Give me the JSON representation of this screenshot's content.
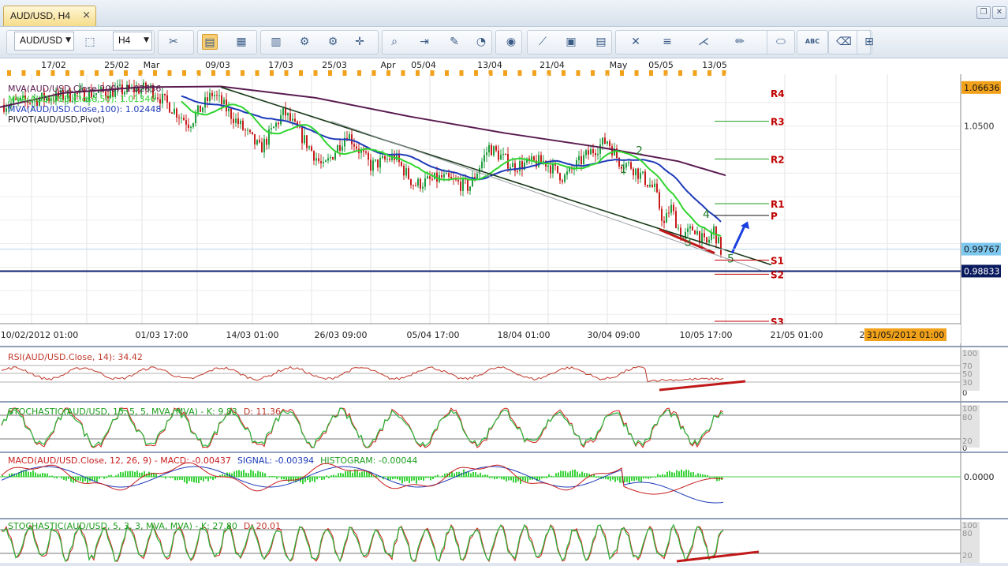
{
  "window": {
    "tab_title": "AUD/USD, H4",
    "close_glyph": "×",
    "restore_glyph": "❐",
    "close_window_glyph": "✕"
  },
  "toolbar": {
    "symbol": "AUD/USD",
    "timeframe": "H4",
    "dropdown_glyph": "▼",
    "icons": [
      {
        "name": "chart-type-icon",
        "glyph": "⬚"
      },
      {
        "name": "remove-indicator-icon",
        "glyph": "✂"
      },
      {
        "name": "chart-template-icon",
        "glyph": "▤"
      },
      {
        "name": "bar-chart-icon",
        "glyph": "▦"
      },
      {
        "name": "candles-icon",
        "glyph": "▥"
      },
      {
        "name": "indicators-icon",
        "glyph": "⚙"
      },
      {
        "name": "strategies-icon",
        "glyph": "⚙"
      },
      {
        "name": "crosshair-icon",
        "glyph": "✛"
      },
      {
        "name": "zoom-icon",
        "glyph": "⌕"
      },
      {
        "name": "autoscroll-icon",
        "glyph": "⇥"
      },
      {
        "name": "chart-edit-icon",
        "glyph": "✎"
      },
      {
        "name": "clock-icon",
        "glyph": "◔"
      },
      {
        "name": "globe-icon",
        "glyph": "◉"
      },
      {
        "name": "ruler-icon",
        "glyph": "⟋"
      },
      {
        "name": "image-icon",
        "glyph": "▣"
      },
      {
        "name": "properties-icon",
        "glyph": "▤"
      },
      {
        "name": "draw-lines-icon",
        "glyph": "✕"
      },
      {
        "name": "horizontal-lines-icon",
        "glyph": "≡"
      },
      {
        "name": "fan-icon",
        "glyph": "⋌"
      },
      {
        "name": "pencil-icon",
        "glyph": "✏"
      },
      {
        "name": "ellipse-icon",
        "glyph": "⬭"
      },
      {
        "name": "text-icon",
        "glyph": "ABC"
      },
      {
        "name": "eraser-icon",
        "glyph": "⌫"
      },
      {
        "name": "hierarchy-icon",
        "glyph": "⊞"
      },
      {
        "name": "more-icon",
        "glyph": "⋮"
      }
    ]
  },
  "main_chart": {
    "legend": [
      {
        "text": "MVA(AUD/USD.Close,200): 1.02836",
        "color": "#5a1b50"
      },
      {
        "text": "MVA(AUD/USD.Close,50): 1.01346",
        "color": "#2fd52f"
      },
      {
        "text": "MVA(AUD/USD.Close,100): 1.02448",
        "color": "#1e3bb8"
      },
      {
        "text": "PIVOT(AUD/USD,Pivot)",
        "color": "#222222"
      }
    ],
    "top_dates": [
      "17/02",
      "25/02",
      "Mar",
      "09/03",
      "17/03",
      "25/03",
      "Apr",
      "05/04",
      "13/04",
      "21/04",
      "May",
      "05/05",
      "13/05"
    ],
    "bottom_dates": [
      "10/02/2012 01:00",
      "01/03 17:00",
      "14/03 01:00",
      "26/03 09:00",
      "05/04 17:00",
      "18/04 01:00",
      "30/04 09:00",
      "10/05 17:00",
      "21/05 01:00",
      "2"
    ],
    "bottom_highlight": "31/05/2012 01:00",
    "price_ticks": [
      "1.0500"
    ],
    "price_labels": {
      "top": "1.06636",
      "current": "0.99767",
      "support": "0.98833"
    },
    "pivot_labels": [
      "R4",
      "R3",
      "R2",
      "R1",
      "P",
      "S1",
      "S2",
      "S3"
    ],
    "wave_labels": [
      "1",
      "2",
      "3",
      "4",
      "5"
    ]
  },
  "indicators": {
    "rsi": {
      "label": "RSI(AUD/USD.Close, 14): 34.42",
      "color": "#c0392b",
      "levels": [
        "100",
        "70",
        "50",
        "30",
        "0"
      ]
    },
    "stoch1": {
      "label": "STOCHASTIC(AUD/USD, 15, 5, 5, MVA, MVA)",
      "k": "K: 9.83",
      "d": "D: 11.36",
      "levels": [
        "100",
        "80",
        "20",
        "0"
      ]
    },
    "macd": {
      "label": "MACD(AUD/USD.Close, 12, 26, 9)",
      "macd": "MACD: -0.00437",
      "signal": "SIGNAL: -0.00394",
      "histogram": "HISTOGRAM: -0.00044",
      "zero": "0.0000"
    },
    "stoch2": {
      "label": "STOCHASTIC(AUD/USD, 5, 3, 3, MVA, MVA)",
      "k": "K: 27.80",
      "d": "D: 20.01",
      "levels": [
        "100",
        "80",
        "20"
      ]
    }
  },
  "colors": {
    "ma200": "#5a1b50",
    "ma50": "#2fd52f",
    "ma100": "#1e3bb8",
    "bull": "#1f9e3f",
    "bear": "#c81d1d",
    "trend": "#1a3a1a",
    "divergence": "#c01818",
    "arrow": "#1b3fe0",
    "support": "#0b1f6e",
    "price_badge": "#7ec8ef",
    "highlight": "#f2a21a"
  }
}
